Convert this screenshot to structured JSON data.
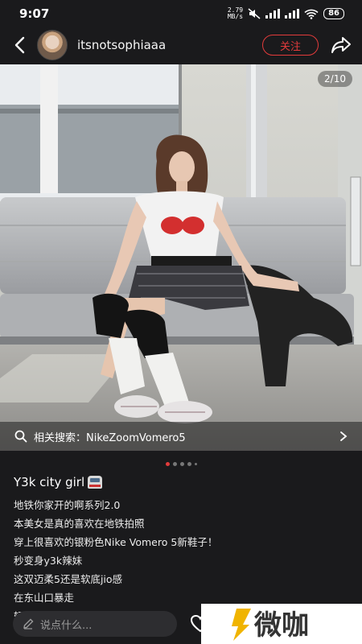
{
  "status_bar": {
    "time": "9:07",
    "network_speed_value": "2.79",
    "network_speed_unit": "MB/s",
    "battery": "86"
  },
  "header": {
    "username": "itsnotsophiaaa",
    "follow_label": "关注"
  },
  "photo": {
    "page_counter": "2/10",
    "related_search": "相关搜索：NikeZoomVomero5"
  },
  "carousel": {
    "dots": 5,
    "active_index": 0
  },
  "caption": {
    "title": "Y3k city girl",
    "lines": [
      "地铁你家开的啊系列2.0",
      "本美女是真的喜欢在地铁拍照",
      "穿上很喜欢的银粉色Nike Vomero 5新鞋子！",
      "秒变身y3k辣妹",
      "这双迈柔5还是软底jio感",
      "在东山口暴走",
      "轻松citywalk一下"
    ]
  },
  "bottom_bar": {
    "comment_placeholder": "说点什么..."
  },
  "watermark": {
    "text": "微咖"
  },
  "colors": {
    "background": "#1a1a1c",
    "accent": "#e23b3b"
  }
}
